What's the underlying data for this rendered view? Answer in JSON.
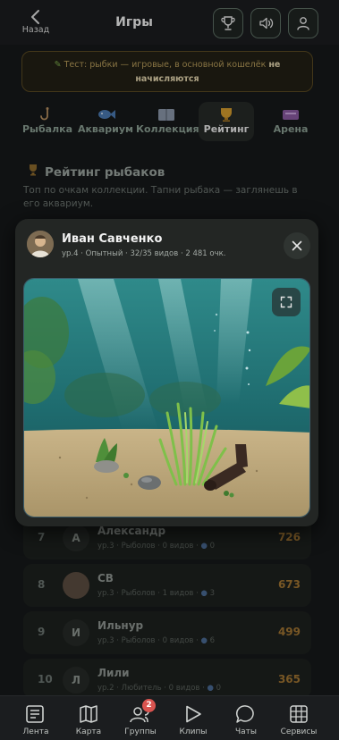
{
  "header": {
    "back_label": "Назад",
    "title": "Игры",
    "buttons": [
      "trophy-icon",
      "sound-icon",
      "profile-icon"
    ]
  },
  "notice": {
    "text": "Тест: рыбки — игровые, в основной кошелёк",
    "bold": "не начисляются"
  },
  "tabs": [
    {
      "label": "Рыбалка",
      "icon": "hook-icon",
      "active": false
    },
    {
      "label": "Аквариум",
      "icon": "fish-icon",
      "active": false
    },
    {
      "label": "Коллекция",
      "icon": "book-icon",
      "active": false
    },
    {
      "label": "Рейтинг",
      "icon": "trophy-icon",
      "active": true
    },
    {
      "label": "Арена",
      "icon": "arena-icon",
      "active": false
    }
  ],
  "rating": {
    "title": "Рейтинг рыбаков",
    "description": "Топ по очкам коллекции. Тапни рыбака — заглянешь в его аквариум."
  },
  "popup": {
    "name": "Иван Савченко",
    "meta": "ур.4 · Опытный · 32/35 видов · 2 481 очк."
  },
  "rows": [
    {
      "rank": "7",
      "avatar": "А",
      "name": "Александр",
      "meta": "ур.3 · Рыболов · 0 видов ·",
      "fish": "0",
      "score": "726"
    },
    {
      "rank": "8",
      "avatar": "",
      "name": "СВ",
      "meta": "ур.3 · Рыболов · 1 видов ·",
      "fish": "3",
      "score": "673"
    },
    {
      "rank": "9",
      "avatar": "И",
      "name": "Ильнур",
      "meta": "ур.3 · Рыболов · 0 видов ·",
      "fish": "6",
      "score": "499"
    },
    {
      "rank": "10",
      "avatar": "Л",
      "name": "Лили",
      "meta": "ур.2 · Любитель · 0 видов ·",
      "fish": "0",
      "score": "365"
    }
  ],
  "bottom_nav": [
    {
      "label": "Лента",
      "icon": "feed-icon"
    },
    {
      "label": "Карта",
      "icon": "map-icon"
    },
    {
      "label": "Группы",
      "icon": "groups-icon",
      "badge": "2"
    },
    {
      "label": "Клипы",
      "icon": "play-icon"
    },
    {
      "label": "Чаты",
      "icon": "chat-icon"
    },
    {
      "label": "Сервисы",
      "icon": "grid-icon"
    }
  ],
  "colors": {
    "accent_gold": "#a07432",
    "badge_red": "#d9534f",
    "active_tab": "#262a27"
  }
}
